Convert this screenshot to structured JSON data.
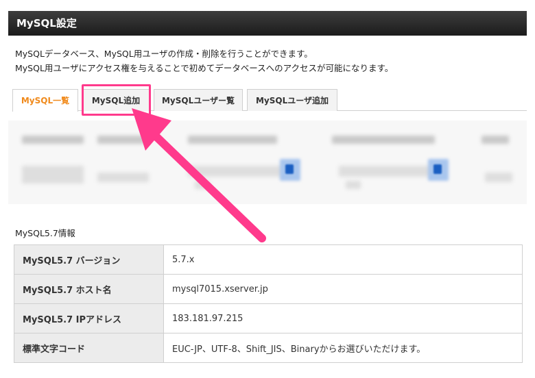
{
  "header": {
    "title": "MySQL設定"
  },
  "description": {
    "line1": "MySQLデータベース、MySQL用ユーザの作成・削除を行うことができます。",
    "line2": "MySQL用ユーザにアクセス権を与えることで初めてデータベースへのアクセスが可能になります。"
  },
  "tabs": [
    {
      "label": "MySQL一覧",
      "active": true
    },
    {
      "label": "MySQL追加",
      "active": false
    },
    {
      "label": "MySQLユーザー覧",
      "active": false
    },
    {
      "label": "MySQLユーザ追加",
      "active": false
    }
  ],
  "info": {
    "section_title": "MySQL5.7情報",
    "rows": [
      {
        "label": "MySQL5.7 バージョン",
        "value": "5.7.x"
      },
      {
        "label": "MySQL5.7 ホスト名",
        "value": "mysql7015.xserver.jp"
      },
      {
        "label": "MySQL5.7 IPアドレス",
        "value": "183.181.97.215"
      },
      {
        "label": "標準文字コード",
        "value": "EUC-JP、UTF-8、Shift_JIS、Binaryからお選びいただけます。"
      }
    ]
  },
  "colors": {
    "active_tab": "#f08a1c",
    "highlight": "#ff3a8c",
    "header_bg": "#2a2a2a"
  }
}
